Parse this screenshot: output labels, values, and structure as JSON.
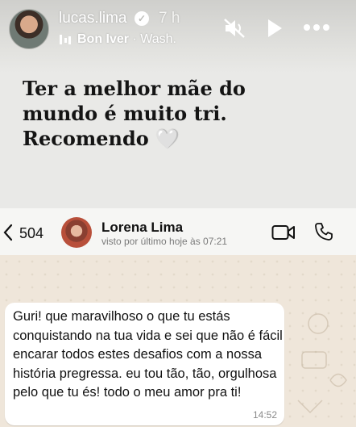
{
  "story": {
    "username": "lucas.lima",
    "verified_badge": "check-icon",
    "time_ago": "7 h",
    "music_artist": "Bon Iver",
    "music_suffix": " · Wash.",
    "caption_lines": [
      "Ter a melhor mãe do",
      "mundo é muito tri.",
      "Recomendo"
    ],
    "caption_emoji": "🤍",
    "icons": [
      "mute-icon",
      "play-icon",
      "more-icon"
    ]
  },
  "whatsapp": {
    "back_count": "504",
    "contact_name": "Lorena Lima",
    "last_seen": "visto por último hoje às 07:21",
    "message": "Guri! que maravilhoso o que tu estás conquistando na tua vida e sei que não é fácil encarar todos estes desafios com a nossa história pregressa. eu tou tão, tão, orgulhosa pelo que tu és! todo o meu amor pra ti!",
    "message_time": "14:52"
  },
  "colors": {
    "background": "#e9e9e7",
    "chat_background": "#efe6da",
    "bubble": "#ffffff"
  }
}
